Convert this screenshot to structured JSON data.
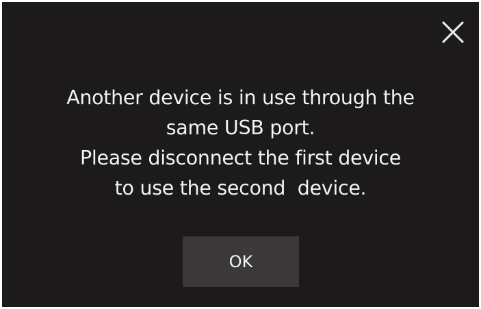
{
  "dialog": {
    "close_icon": "close-icon",
    "message_lines": [
      "Another device is in use through the",
      "same USB port.",
      "Please disconnect the first device",
      "to use the second  device."
    ],
    "ok_label": "OK"
  },
  "colors": {
    "background": "#1c1a1a",
    "button": "#3a3838",
    "text": "#f3f3f3"
  }
}
